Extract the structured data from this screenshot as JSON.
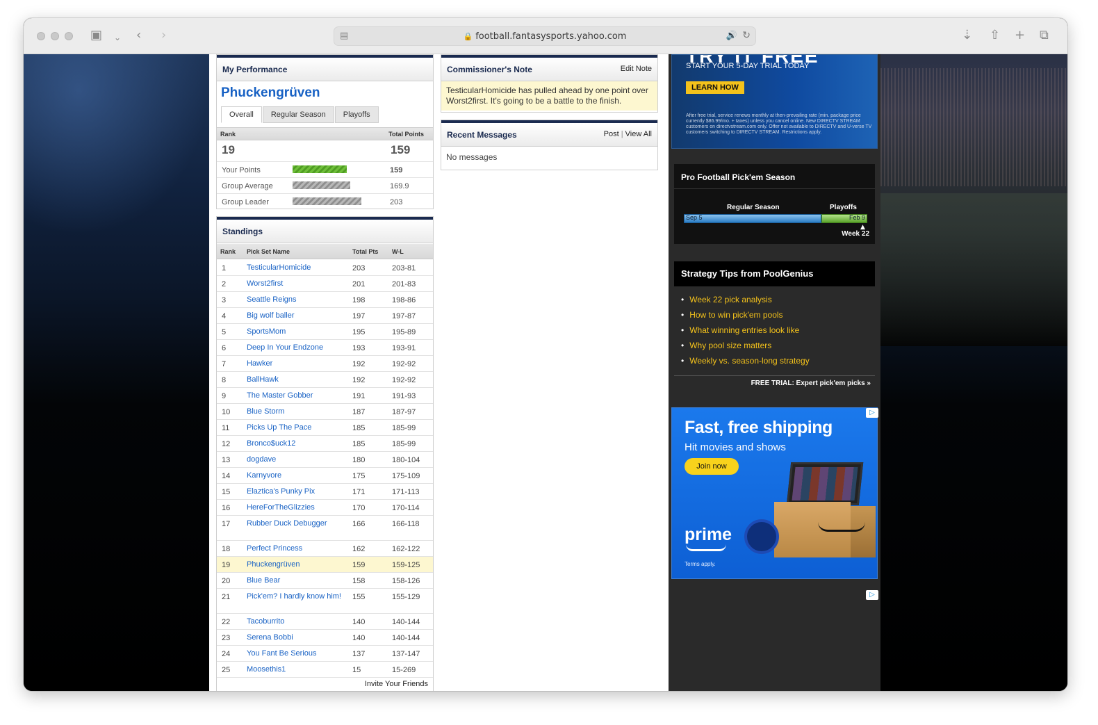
{
  "browser": {
    "url": "football.fantasysports.yahoo.com"
  },
  "performance": {
    "title": "My Performance",
    "name": "Phuckengrüven",
    "tabs": [
      "Overall",
      "Regular Season",
      "Playoffs"
    ],
    "rank_label": "Rank",
    "total_points_label": "Total Points",
    "rank": "19",
    "total_points": "159",
    "rows": [
      {
        "label": "Your Points",
        "value": "159",
        "bar_fraction": 0.783,
        "style": "green"
      },
      {
        "label": "Group Average",
        "value": "169.9",
        "bar_fraction": 0.837,
        "style": "gray"
      },
      {
        "label": "Group Leader",
        "value": "203",
        "bar_fraction": 1.0,
        "style": "gray"
      }
    ]
  },
  "standings": {
    "title": "Standings",
    "columns": [
      "Rank",
      "Pick Set Name",
      "Total Pts",
      "W-L"
    ],
    "rows": [
      {
        "rank": "1",
        "name": "TesticularHomicide",
        "pts": "203",
        "wl": "203-81"
      },
      {
        "rank": "2",
        "name": "Worst2first",
        "pts": "201",
        "wl": "201-83"
      },
      {
        "rank": "3",
        "name": "Seattle Reigns",
        "pts": "198",
        "wl": "198-86"
      },
      {
        "rank": "4",
        "name": "Big wolf baller",
        "pts": "197",
        "wl": "197-87"
      },
      {
        "rank": "5",
        "name": "SportsMom",
        "pts": "195",
        "wl": "195-89"
      },
      {
        "rank": "6",
        "name": "Deep In Your Endzone",
        "pts": "193",
        "wl": "193-91"
      },
      {
        "rank": "7",
        "name": "Hawker",
        "pts": "192",
        "wl": "192-92"
      },
      {
        "rank": "8",
        "name": "BallHawk",
        "pts": "192",
        "wl": "192-92"
      },
      {
        "rank": "9",
        "name": "The Master Gobber",
        "pts": "191",
        "wl": "191-93"
      },
      {
        "rank": "10",
        "name": "Blue Storm",
        "pts": "187",
        "wl": "187-97"
      },
      {
        "rank": "11",
        "name": "Picks Up The Pace",
        "pts": "185",
        "wl": "185-99"
      },
      {
        "rank": "12",
        "name": "Bronco$uck12",
        "pts": "185",
        "wl": "185-99"
      },
      {
        "rank": "13",
        "name": "dogdave",
        "pts": "180",
        "wl": "180-104"
      },
      {
        "rank": "14",
        "name": "Karnyvore",
        "pts": "175",
        "wl": "175-109"
      },
      {
        "rank": "15",
        "name": "Elaztica's Punky Pix",
        "pts": "171",
        "wl": "171-113"
      },
      {
        "rank": "16",
        "name": "HereForTheGlizzies",
        "pts": "170",
        "wl": "170-114"
      },
      {
        "rank": "17",
        "name": "Rubber Duck Debugger",
        "pts": "166",
        "wl": "166-118"
      },
      {
        "rank": "18",
        "name": "Perfect Princess",
        "pts": "162",
        "wl": "162-122"
      },
      {
        "rank": "19",
        "name": "Phuckengrüven",
        "pts": "159",
        "wl": "159-125",
        "highlight": true
      },
      {
        "rank": "20",
        "name": "Blue Bear",
        "pts": "158",
        "wl": "158-126"
      },
      {
        "rank": "21",
        "name": "Pick'em? I hardly know him!",
        "pts": "155",
        "wl": "155-129"
      },
      {
        "rank": "22",
        "name": "Tacoburrito",
        "pts": "140",
        "wl": "140-144"
      },
      {
        "rank": "23",
        "name": "Serena Bobbi",
        "pts": "140",
        "wl": "140-144"
      },
      {
        "rank": "24",
        "name": "You Fant Be Serious",
        "pts": "137",
        "wl": "137-147"
      },
      {
        "rank": "25",
        "name": "Moosethis1",
        "pts": "15",
        "wl": "15-269"
      }
    ],
    "invite": "Invite Your Friends"
  },
  "commissioner": {
    "title": "Commissioner's Note",
    "edit": "Edit Note",
    "note": "TesticularHomicide has pulled ahead by one point over Worst2first. It's going to be a battle to the finish."
  },
  "messages": {
    "title": "Recent Messages",
    "post": "Post",
    "sep": "|",
    "view_all": "View All",
    "empty": "No messages"
  },
  "ad_directv": {
    "headline": "TRY IT FREE",
    "sub": "START YOUR 5-DAY TRIAL TODAY",
    "button": "LEARN HOW",
    "fine": "After free trial, service renews monthly at then-prevailing rate (min. package price currently $86.99/mo. + taxes) unless you cancel online. New DIRECTV STREAM customers on directvstream.com only. Offer not available to DIRECTV and U-verse TV customers switching to DIRECTV STREAM. Restrictions apply."
  },
  "pickem": {
    "title": "Pro Football Pick'em Season",
    "regular_label": "Regular Season",
    "playoffs_label": "Playoffs",
    "start": "Sep 5",
    "end": "Feb 9",
    "week": "Week 22"
  },
  "tips": {
    "title": "Strategy Tips from PoolGenius",
    "items": [
      "Week 22 pick analysis",
      "How to win pick'em pools",
      "What winning entries look like",
      "Why pool size matters",
      "Weekly vs. season-long strategy"
    ],
    "footer": "FREE TRIAL: Expert pick'em picks »"
  },
  "ad_prime": {
    "headline": "Fast, free shipping",
    "sub": "Hit movies and shows",
    "button": "Join now",
    "brand": "prime",
    "terms": "Terms apply."
  },
  "colors": {
    "navy": "#1a2a4f",
    "link": "#1761c4",
    "gold": "#f4c21b",
    "highlight": "#fdf7d0"
  }
}
